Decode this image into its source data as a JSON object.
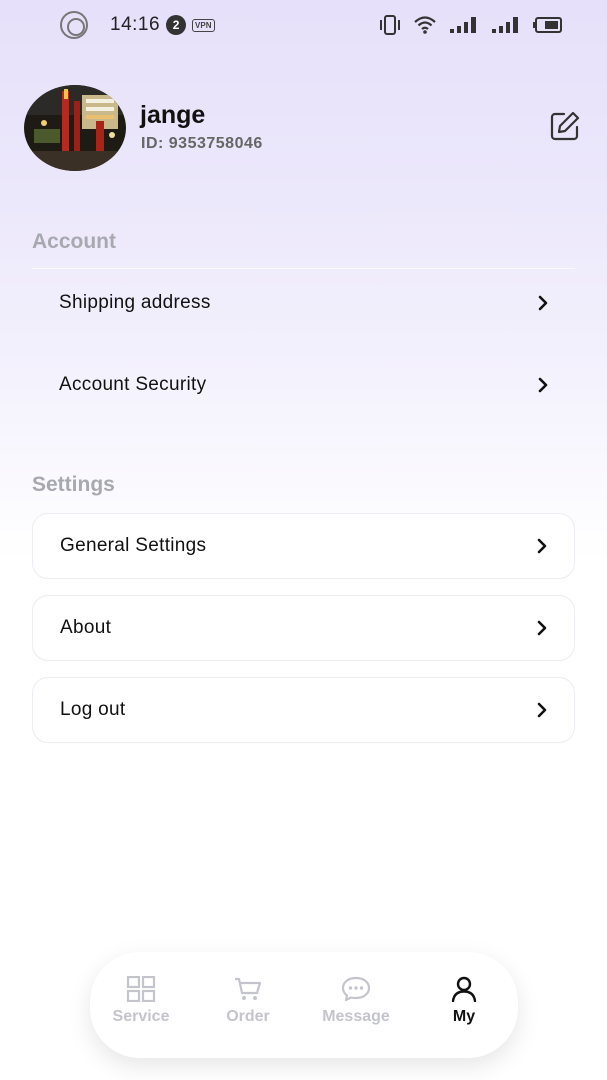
{
  "status_bar": {
    "time": "14:16",
    "notification_count": "2",
    "vpn_label": "VPN",
    "icons": [
      "ring-icon",
      "vibrate-icon",
      "wifi-icon",
      "signal-icon",
      "signal-icon",
      "battery-icon"
    ]
  },
  "profile": {
    "username": "jange",
    "id_text": "ID:  9353758046",
    "edit_icon": "edit-icon"
  },
  "account": {
    "title": "Account",
    "items": [
      {
        "label": "Shipping address"
      },
      {
        "label": "Account Security"
      }
    ]
  },
  "settings": {
    "title": "Settings",
    "items": [
      {
        "label": "General Settings"
      },
      {
        "label": "About"
      },
      {
        "label": "Log out"
      }
    ]
  },
  "tab_bar": {
    "tabs": [
      {
        "label": "Service",
        "icon": "grid-icon",
        "active": false
      },
      {
        "label": "Order",
        "icon": "cart-icon",
        "active": false
      },
      {
        "label": "Message",
        "icon": "chat-icon",
        "active": false
      },
      {
        "label": "My",
        "icon": "person-icon",
        "active": true
      }
    ]
  },
  "colors": {
    "accent_bg": "#e6e0fa",
    "section_title": "#a8a8b0",
    "tab_inactive": "#c4c4cc",
    "tab_active": "#111111"
  }
}
